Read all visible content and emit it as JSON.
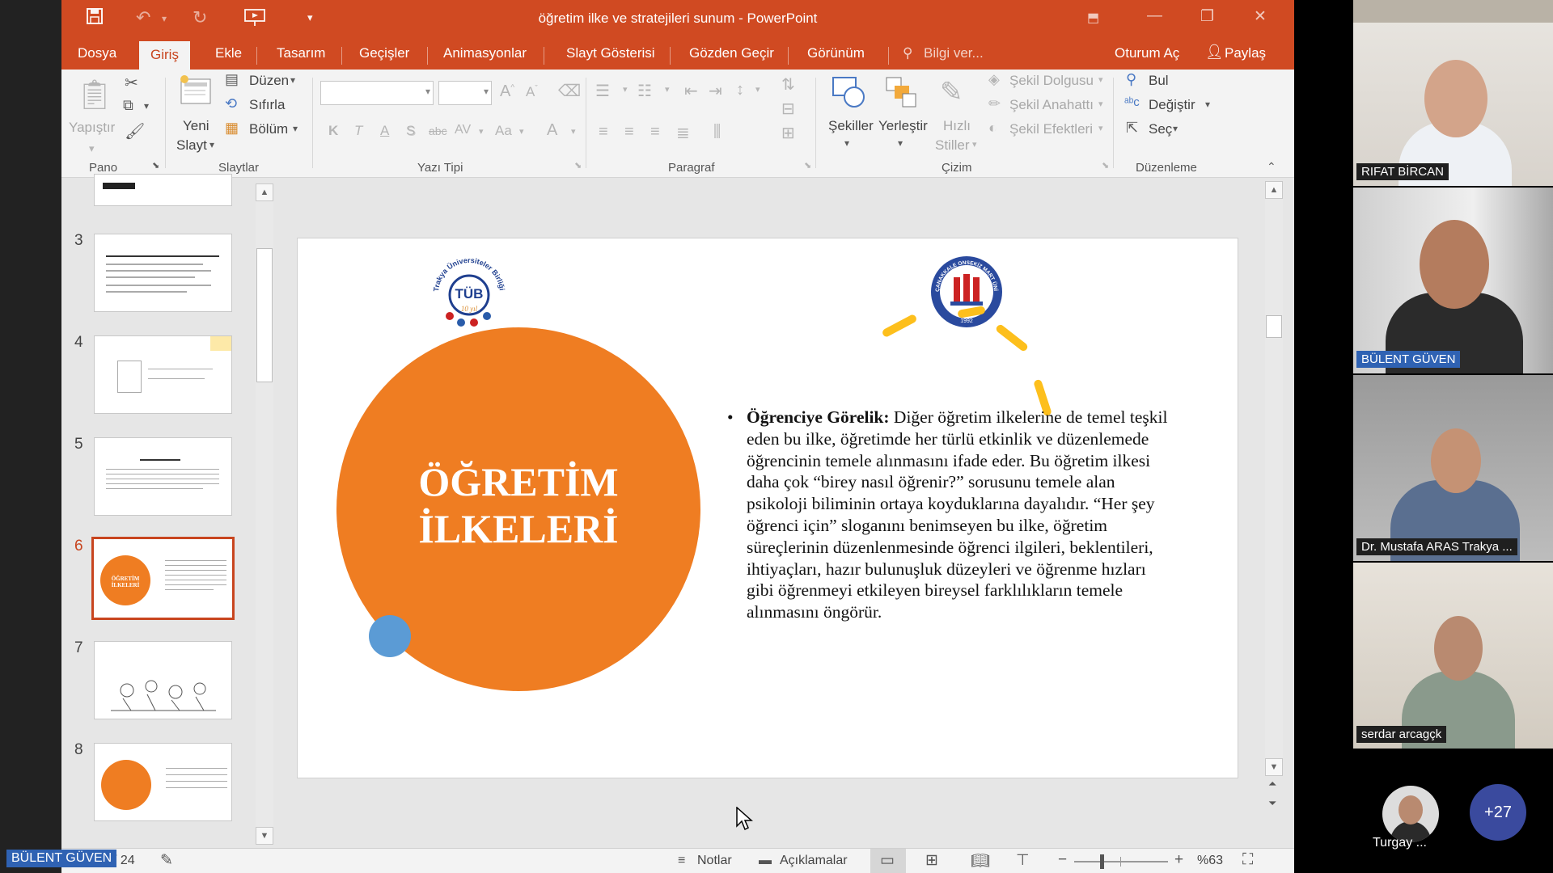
{
  "window": {
    "title": "öğretim ilke ve stratejileri sunum - PowerPoint"
  },
  "tabs": {
    "file": "Dosya",
    "home": "Giriş",
    "insert": "Ekle",
    "design": "Tasarım",
    "transitions": "Geçişler",
    "animations": "Animasyonlar",
    "slideshow": "Slayt Gösterisi",
    "review": "Gözden Geçir",
    "view": "Görünüm",
    "tellme": "Bilgi ver...",
    "signin": "Oturum Aç",
    "share": "Paylaş"
  },
  "ribbon": {
    "paste": "Yapıştır",
    "new_slide_1": "Yeni",
    "new_slide_2": "Slayt",
    "layout": "Düzen",
    "reset": "Sıfırla",
    "section": "Bölüm",
    "shapes": "Şekiller",
    "arrange": "Yerleştir",
    "quick_styles_1": "Hızlı",
    "quick_styles_2": "Stiller",
    "shape_fill": "Şekil Dolgusu",
    "shape_outline": "Şekil Anahattı",
    "shape_effects": "Şekil Efektleri",
    "find": "Bul",
    "replace": "Değiştir",
    "select": "Seç",
    "groups": {
      "clipboard": "Pano",
      "slides": "Slaytlar",
      "font": "Yazı Tipi",
      "paragraph": "Paragraf",
      "drawing": "Çizim",
      "editing": "Düzenleme"
    },
    "font_buttons": {
      "bold": "K",
      "italic": "T",
      "underline": "A",
      "shadow": "S",
      "strike": "abc",
      "spacing": "AV",
      "case": "Aa",
      "color": "A"
    }
  },
  "thumbnails": {
    "numbers": [
      "3",
      "4",
      "5",
      "6",
      "7",
      "8"
    ],
    "active": "6",
    "active_label": "ÖĞRETİM İLKELERİ"
  },
  "slide": {
    "title_line1": "ÖĞRETİM",
    "title_line2": "İLKELERİ",
    "bullet": "•",
    "body_bold": "Öğrenciye Görelik:",
    "body_text": " Diğer öğretim ilkelerine de temel teşkil eden bu ilke, öğretimde her türlü etkinlik ve düzenlemede öğrencinin temele alınmasını ifade eder. Bu öğretim ilkesi daha çok “birey nasıl öğrenir?” sorusunu temele alan psikoloji biliminin ortaya koyduklarına dayalıdır. “Her şey öğrenci için” sloganını benimseyen bu ilke, öğretim süreçlerinin düzenlenmesinde öğrenci ilgileri, beklentileri, ihtiyaçları, hazır bulunuşluk düzeyleri ve öğrenme hızları gibi öğrenmeyi etkileyen bireysel farklılıkların temele alınmasını öngörür.",
    "logo_left_text": "TÜB",
    "logo_left_ring": "Trakya Üniversiteler Birliği",
    "logo_left_sub": "10 yıl",
    "logo_right_ring": "ÇANAKKALE ONSEKİZ MART ÜNİVERSİTESİ",
    "logo_right_year": "1992",
    "accent_orange": "#ef7d22",
    "accent_blue": "#5b9bd5",
    "accent_yellow": "#fdbf1c"
  },
  "statusbar": {
    "slide_total": "/ 24",
    "notes": "Notlar",
    "comments": "Açıklamalar",
    "zoom": "%63",
    "zoom_fraction": 0.63
  },
  "meeting": {
    "speaker_label": "BÜLENT GÜVEN",
    "participants": [
      {
        "name": "RIFAT BİRCAN"
      },
      {
        "name": "BÜLENT GÜVEN"
      },
      {
        "name": "Dr. Mustafa ARAS Trakya ..."
      },
      {
        "name": "serdar arcagçk"
      }
    ],
    "avatar_name": "Turgay ...",
    "more_count": "+27"
  },
  "colors": {
    "ribbon_accent": "#d04a22",
    "speaker_highlight": "#2f62b3"
  }
}
